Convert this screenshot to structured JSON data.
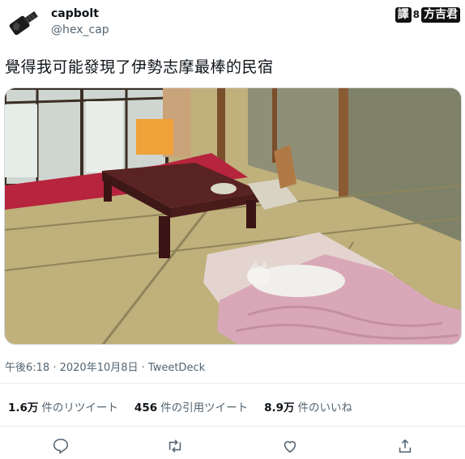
{
  "user": {
    "display_name": "capbolt",
    "handle": "@hex_cap"
  },
  "watermark": {
    "mark1": "譯",
    "mark2": "8",
    "mark3": "方吉君"
  },
  "tweet": {
    "text": "覺得我可能發現了伊勢志摩最棒的民宿"
  },
  "meta": {
    "time": "午後6:18",
    "sep1": " · ",
    "date": "2020年10月8日",
    "sep2": " · ",
    "client": "TweetDeck"
  },
  "stats": [
    {
      "count": "1.6万",
      "label": "件のリツイート"
    },
    {
      "count": "456",
      "label": "件の引用ツイート"
    },
    {
      "count": "8.9万",
      "label": "件のいいね"
    }
  ],
  "icons": {
    "reply": "reply-icon",
    "retweet": "retweet-icon",
    "like": "like-icon",
    "share": "share-icon"
  },
  "colors": {
    "text": "#0f1419",
    "secondary": "#536471",
    "divider": "#e6ecf0"
  }
}
